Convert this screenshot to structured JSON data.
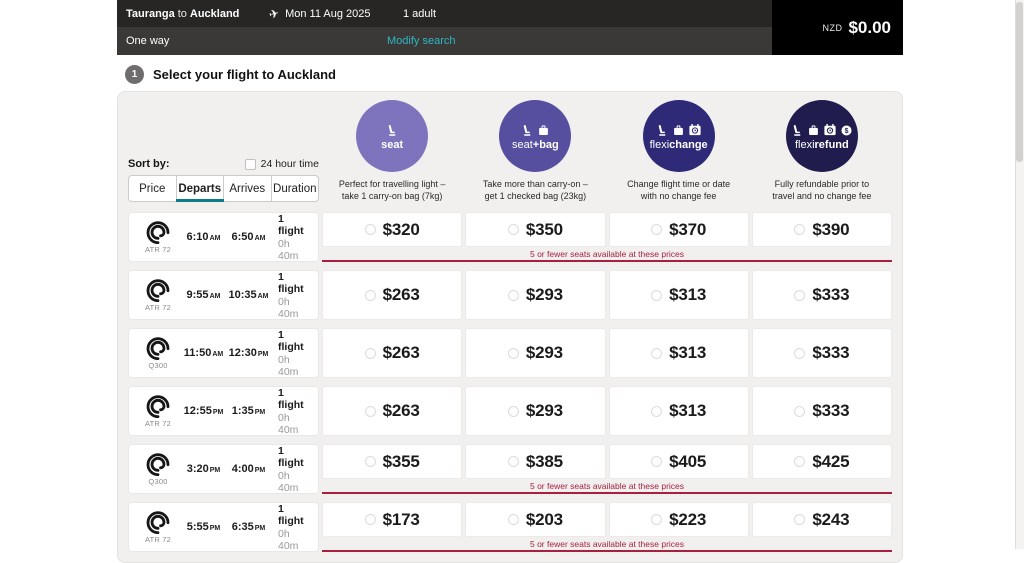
{
  "header": {
    "origin": "Tauranga",
    "to_word": "to",
    "destination": "Auckland",
    "date": "Mon 11 Aug 2025",
    "passengers": "1 adult",
    "trip_type": "One way",
    "modify_search_label": "Modify search",
    "currency_code": "NZD",
    "total_amount": "$0.00"
  },
  "step": {
    "number": "1",
    "title": "Select your flight to Auckland"
  },
  "sort": {
    "label": "Sort by:",
    "time_format_label": "24 hour time",
    "time_format_checked": false,
    "options": [
      "Price",
      "Departs",
      "Arrives",
      "Duration"
    ],
    "selected_option": "Departs"
  },
  "fare_types": [
    {
      "id": "seat",
      "color": "#7e74bd",
      "label_light": "",
      "label_bold": "seat",
      "icons": [
        "seat"
      ],
      "desc": [
        "Perfect for travelling light –",
        "take 1 carry-on bag (7kg)"
      ]
    },
    {
      "id": "seat-bag",
      "color": "#564fa0",
      "label_light": "seat",
      "label_bold": "+bag",
      "icons": [
        "seat",
        "bag"
      ],
      "desc": [
        "Take more than carry-on –",
        "get 1 checked bag (23kg)"
      ]
    },
    {
      "id": "flexichange",
      "color": "#2f2a78",
      "label_light": "flexi",
      "label_bold": "change",
      "icons": [
        "seat",
        "bag",
        "calendar"
      ],
      "desc": [
        "Change flight time or date",
        "with no change fee"
      ]
    },
    {
      "id": "flexirefund",
      "color": "#201c4e",
      "label_light": "flexi",
      "label_bold": "refund",
      "icons": [
        "seat",
        "bag",
        "calendar",
        "coin"
      ],
      "desc": [
        "Fully refundable prior to",
        "travel and no change fee"
      ]
    }
  ],
  "low_seats_note": "5 or fewer seats available at these prices",
  "flights": [
    {
      "aircraft": "ATR 72",
      "depart_time": "6:10",
      "depart_mer": "AM",
      "arrive_time": "6:50",
      "arrive_mer": "AM",
      "stops": "1 flight",
      "duration": "0h 40m",
      "prices": [
        "$320",
        "$350",
        "$370",
        "$390"
      ],
      "has_note": true
    },
    {
      "aircraft": "ATR 72",
      "depart_time": "9:55",
      "depart_mer": "AM",
      "arrive_time": "10:35",
      "arrive_mer": "AM",
      "stops": "1 flight",
      "duration": "0h 40m",
      "prices": [
        "$263",
        "$293",
        "$313",
        "$333"
      ],
      "has_note": false
    },
    {
      "aircraft": "Q300",
      "depart_time": "11:50",
      "depart_mer": "AM",
      "arrive_time": "12:30",
      "arrive_mer": "PM",
      "stops": "1 flight",
      "duration": "0h 40m",
      "prices": [
        "$263",
        "$293",
        "$313",
        "$333"
      ],
      "has_note": false
    },
    {
      "aircraft": "ATR 72",
      "depart_time": "12:55",
      "depart_mer": "PM",
      "arrive_time": "1:35",
      "arrive_mer": "PM",
      "stops": "1 flight",
      "duration": "0h 40m",
      "prices": [
        "$263",
        "$293",
        "$313",
        "$333"
      ],
      "has_note": false
    },
    {
      "aircraft": "Q300",
      "depart_time": "3:20",
      "depart_mer": "PM",
      "arrive_time": "4:00",
      "arrive_mer": "PM",
      "stops": "1 flight",
      "duration": "0h 40m",
      "prices": [
        "$355",
        "$385",
        "$405",
        "$425"
      ],
      "has_note": true
    },
    {
      "aircraft": "ATR 72",
      "depart_time": "5:55",
      "depart_mer": "PM",
      "arrive_time": "6:35",
      "arrive_mer": "PM",
      "stops": "1 flight",
      "duration": "0h 40m",
      "prices": [
        "$173",
        "$203",
        "$223",
        "$243"
      ],
      "has_note": true
    }
  ]
}
